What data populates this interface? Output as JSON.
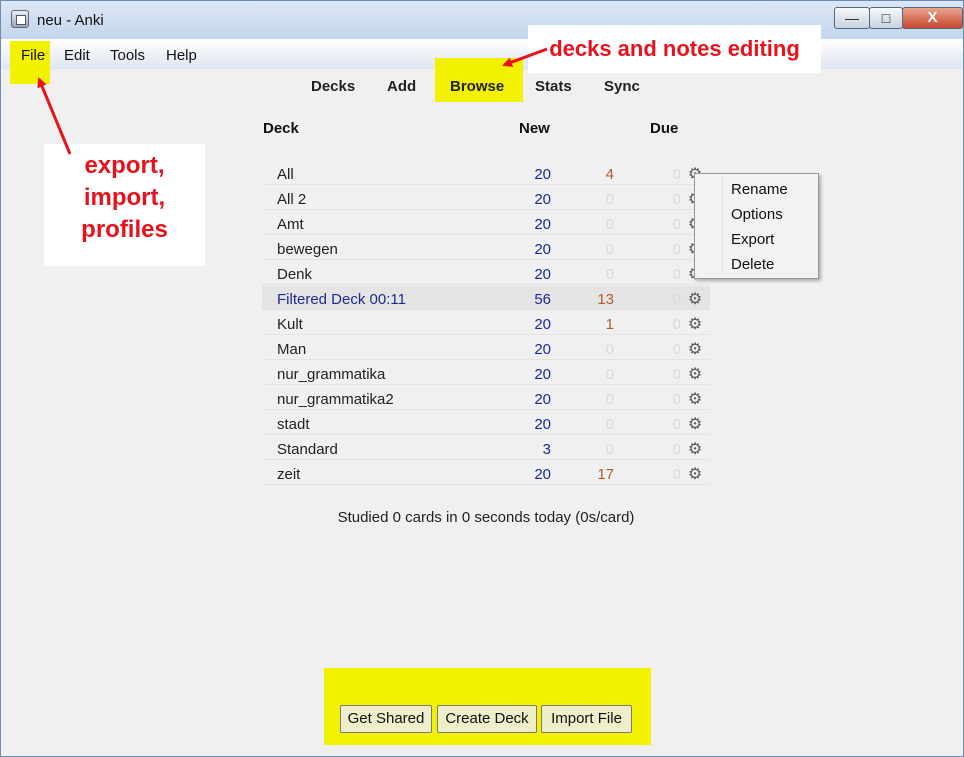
{
  "window": {
    "title": "neu - Anki",
    "min_label": "—",
    "max_label": "□",
    "close_label": "X"
  },
  "menu": [
    {
      "label": "File"
    },
    {
      "label": "Edit"
    },
    {
      "label": "Tools"
    },
    {
      "label": "Help"
    }
  ],
  "toolbar": [
    {
      "label": "Decks"
    },
    {
      "label": "Add"
    },
    {
      "label": "Browse"
    },
    {
      "label": "Stats"
    },
    {
      "label": "Sync"
    }
  ],
  "columns": {
    "deck": "Deck",
    "new": "New",
    "due": "Due"
  },
  "decks": [
    {
      "name": "All",
      "new": "20",
      "learn": "4",
      "due": "0"
    },
    {
      "name": "All 2",
      "new": "20",
      "learn": "0",
      "due": "0"
    },
    {
      "name": "Amt",
      "new": "20",
      "learn": "0",
      "due": "0"
    },
    {
      "name": "bewegen",
      "new": "20",
      "learn": "0",
      "due": "0"
    },
    {
      "name": "Denk",
      "new": "20",
      "learn": "0",
      "due": "0"
    },
    {
      "name": "Filtered Deck 00:11",
      "new": "56",
      "learn": "13",
      "due": "0",
      "selected": true
    },
    {
      "name": "Kult",
      "new": "20",
      "learn": "1",
      "due": "0"
    },
    {
      "name": "Man",
      "new": "20",
      "learn": "0",
      "due": "0"
    },
    {
      "name": "nur_grammatika",
      "new": "20",
      "learn": "0",
      "due": "0"
    },
    {
      "name": "nur_grammatika2",
      "new": "20",
      "learn": "0",
      "due": "0"
    },
    {
      "name": "stadt",
      "new": "20",
      "learn": "0",
      "due": "0"
    },
    {
      "name": "Standard",
      "new": "3",
      "learn": "0",
      "due": "0"
    },
    {
      "name": "zeit",
      "new": "20",
      "learn": "17",
      "due": "0"
    }
  ],
  "gear_glyph": "⚙",
  "context_menu": [
    {
      "label": "Rename"
    },
    {
      "label": "Options"
    },
    {
      "label": "Export"
    },
    {
      "label": "Delete"
    }
  ],
  "studied_text": "Studied 0 cards in 0 seconds today (0s/card)",
  "buttons": {
    "get_shared": "Get Shared",
    "create_deck": "Create Deck",
    "import_file": "Import File"
  },
  "annotations": {
    "left_line1": "export,",
    "left_line2": "import,",
    "left_line3": "profiles",
    "top": "decks and notes editing"
  },
  "colors": {
    "highlight": "#f2f200",
    "annotation_text": "#e8121c",
    "new_count": "#1a2a99",
    "learn_count": "#b75a2a",
    "zero_count": "#dadada"
  }
}
